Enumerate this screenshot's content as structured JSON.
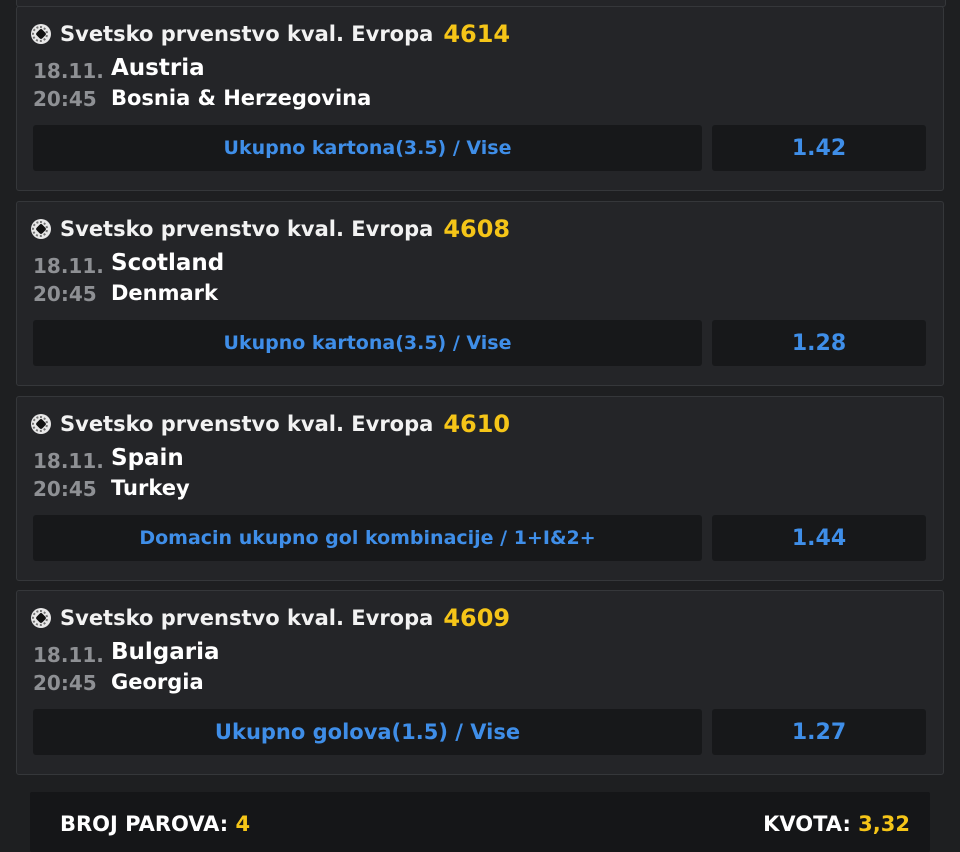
{
  "matches": [
    {
      "league": "Svetsko prvenstvo kval. Evropa",
      "code": "4614",
      "date": "18.11.",
      "time": "20:45",
      "home": "Austria",
      "away": "Bosnia & Herzegovina",
      "market": "Ukupno kartona(3.5) / Vise",
      "odd": "1.42"
    },
    {
      "league": "Svetsko prvenstvo kval. Evropa",
      "code": "4608",
      "date": "18.11.",
      "time": "20:45",
      "home": "Scotland",
      "away": "Denmark",
      "market": "Ukupno kartona(3.5) / Vise",
      "odd": "1.28"
    },
    {
      "league": "Svetsko prvenstvo kval. Evropa",
      "code": "4610",
      "date": "18.11.",
      "time": "20:45",
      "home": "Spain",
      "away": "Turkey",
      "market": "Domacin ukupno gol kombinacije / 1+I&2+",
      "odd": "1.44"
    },
    {
      "league": "Svetsko prvenstvo kval. Evropa",
      "code": "4609",
      "date": "18.11.",
      "time": "20:45",
      "home": "Bulgaria",
      "away": "Georgia",
      "market": "Ukupno golova(1.5) / Vise",
      "odd": "1.27"
    }
  ],
  "footer": {
    "pairs_label": "BROJ PAROVA:",
    "pairs_value": "4",
    "odds_label": "KVOTA:",
    "odds_value": "3,32"
  },
  "icons": {
    "sport": "soccer-ball-icon"
  },
  "colors": {
    "accent": "#f5c518",
    "link": "#3f8ee8",
    "background": "#1e1f21",
    "card": "#242528"
  }
}
